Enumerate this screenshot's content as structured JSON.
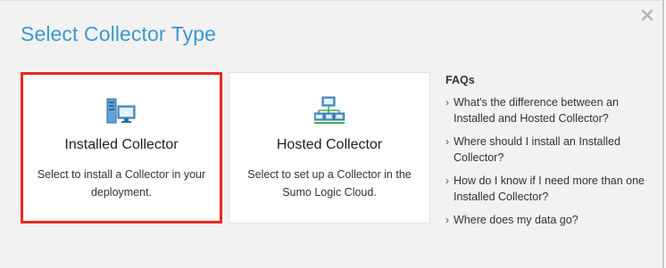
{
  "dialog": {
    "title": "Select Collector Type",
    "close_icon": "close-icon"
  },
  "cards": [
    {
      "title": "Installed Collector",
      "description": "Select to install a Collector in your deployment.",
      "icon": "server-computer-icon",
      "selected": true
    },
    {
      "title": "Hosted Collector",
      "description": "Select to set up a Collector in the Sumo Logic Cloud.",
      "icon": "network-cloud-icon",
      "selected": false
    }
  ],
  "faqs": {
    "title": "FAQs",
    "items": [
      "What's the difference between an Installed and Hosted Collector?",
      "Where should I install an Installed Collector?",
      "How do I know if I need more than one Installed Collector?",
      "Where does my data go?"
    ],
    "chevron_icon": "chevron-right-icon"
  },
  "colors": {
    "accent": "#3a99cf",
    "selected_border": "#e8281e",
    "background": "#f2f2f2"
  }
}
